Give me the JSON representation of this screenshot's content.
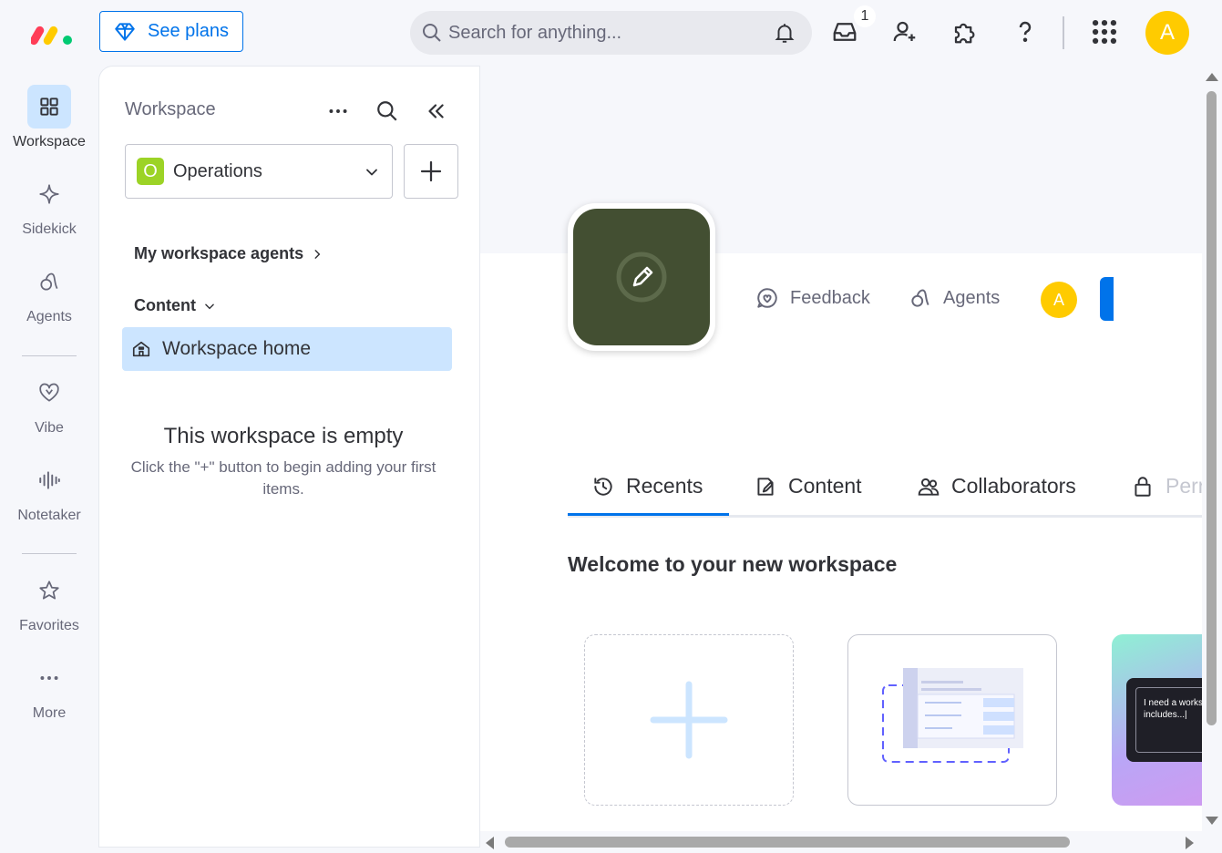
{
  "topbar": {
    "see_plans_label": "See plans",
    "search_placeholder": "Search for anything...",
    "inbox_badge": "1",
    "avatar_initial": "A"
  },
  "leftnav": {
    "items": [
      {
        "label": "Workspace"
      },
      {
        "label": "Sidekick"
      },
      {
        "label": "Agents"
      },
      {
        "label": "Vibe"
      },
      {
        "label": "Notetaker"
      },
      {
        "label": "Favorites"
      },
      {
        "label": "More"
      }
    ]
  },
  "panel": {
    "title": "Workspace",
    "workspace_name": "Operations",
    "workspace_initial": "O",
    "agents_link": "My workspace agents",
    "content_link": "Content",
    "home_item": "Workspace home",
    "empty_title": "This workspace is empty",
    "empty_sub": "Click the \"+\" button to begin adding your first items."
  },
  "main": {
    "feedback_label": "Feedback",
    "agents_label": "Agents",
    "avatar_initial": "A",
    "tabs": [
      {
        "label": "Recents"
      },
      {
        "label": "Content"
      },
      {
        "label": "Collaborators"
      },
      {
        "label": "Perr"
      }
    ],
    "welcome": "Welcome to your new workspace",
    "ai_prompt": "I need a works includes...|"
  },
  "colors": {
    "accent": "#0073ea",
    "selected_bg": "#cce5ff",
    "avatar": "#ffcb00",
    "workspace_badge": "#9cd326",
    "workspace_logo": "#434f32"
  }
}
